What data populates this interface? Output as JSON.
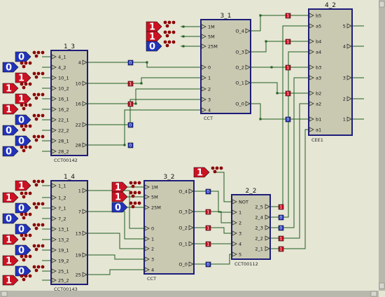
{
  "colors": {
    "background": "#e6e6d5",
    "chip_fill": "#c9c9b2",
    "chip_border": "#1d1d7a",
    "wire": "#1f5f1f",
    "logic_high": "#cc1122",
    "logic_low": "#2233bb",
    "pin_dot": "#8b0000",
    "scroll_track": "#b8b8ac"
  },
  "chips": {
    "c13": {
      "title": "1_3",
      "part": "CCT00142",
      "inputs": [
        "4_1",
        "4_2",
        "10_1",
        "10_2",
        "16_1",
        "16_2",
        "22_1",
        "22_2",
        "28_1",
        "28_2"
      ],
      "outputs": [
        "4",
        "10",
        "16",
        "22",
        "28"
      ]
    },
    "c14": {
      "title": "1_4",
      "part": "CCT00143",
      "inputs": [
        "1_1",
        "1_2",
        "7_1",
        "7_2",
        "13_1",
        "13_2",
        "19_1",
        "19_2",
        "25_1",
        "25_2"
      ],
      "outputs": [
        "1",
        "7",
        "13",
        "19",
        "25"
      ]
    },
    "c31": {
      "title": "3_1",
      "part": "CCT",
      "clock_inputs": [
        "1M",
        "5M",
        "25M"
      ],
      "inputs": [
        "0",
        "1",
        "2",
        "3",
        "4"
      ],
      "outputs": [
        "O_4",
        "O_3",
        "O_2",
        "O_1",
        "O_0"
      ]
    },
    "c32": {
      "title": "3_2",
      "part": "CCT",
      "clock_inputs": [
        "1M",
        "5M",
        "25M"
      ],
      "inputs": [
        "0",
        "1",
        "2",
        "3",
        "4"
      ],
      "outputs": [
        "O_4",
        "O_3",
        "O_2",
        "O_1",
        "O_0"
      ]
    },
    "c22": {
      "title": "2_2",
      "part": "CCT00112",
      "inputs": [
        "NOT",
        "1",
        "2",
        "3",
        "4",
        "5"
      ],
      "outputs": [
        "2_5",
        "2_4",
        "2_3",
        "2_2",
        "2_1"
      ]
    },
    "c42": {
      "title": "4_2",
      "part": "CEE1",
      "inputs": [
        "b5",
        "a5",
        "b4",
        "a4",
        "b3",
        "a3",
        "b2",
        "a2",
        "b1",
        "a1"
      ],
      "outputs": [
        "5",
        "4",
        "3",
        "2",
        "1"
      ]
    }
  },
  "sources": {
    "c13": [
      "0",
      "0",
      "1",
      "1",
      "1",
      "1",
      "0",
      "0",
      "0",
      "0"
    ],
    "c14": [
      "1",
      "1",
      "0",
      "0",
      "0",
      "1",
      "0",
      "1",
      "0",
      "1"
    ],
    "c31_clock": [
      "1",
      "1",
      "0"
    ],
    "c32_clock": [
      "1",
      "1",
      "0"
    ],
    "c22_not": "1"
  },
  "probes": {
    "c13_out": [
      "0",
      "1",
      "1",
      "0",
      "0"
    ],
    "c31_out": [
      "1",
      "1",
      "1",
      "1",
      "0"
    ],
    "c32_out": [
      "0",
      "1",
      "1",
      "1",
      "0"
    ],
    "c22_out": [
      "1",
      "0",
      "0",
      "1",
      "1"
    ],
    "c42_in": [
      "1",
      "1",
      "1",
      "1",
      "1"
    ]
  }
}
